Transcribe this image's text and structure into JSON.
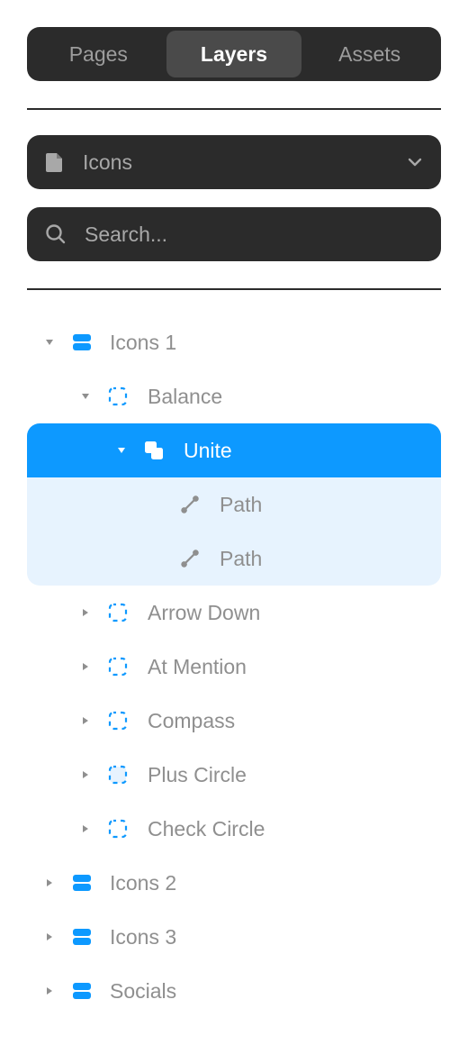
{
  "tabs": [
    {
      "label": "Pages",
      "active": false
    },
    {
      "label": "Layers",
      "active": true
    },
    {
      "label": "Assets",
      "active": false
    }
  ],
  "page_selector": {
    "icon": "page-icon",
    "label": "Icons",
    "chevron": "chevron-down-icon"
  },
  "search": {
    "icon": "search-icon",
    "placeholder": "Search...",
    "value": ""
  },
  "colors": {
    "accent": "#0d99ff",
    "selection_bg": "#e7f3fe",
    "panel_dark": "#2b2b2b"
  },
  "layers": {
    "icons1": {
      "label": "Icons 1",
      "icon": "section-icon",
      "expanded": true
    },
    "balance": {
      "label": "Balance",
      "icon": "frame-icon",
      "expanded": true
    },
    "unite": {
      "label": "Unite",
      "icon": "boolean-union-icon",
      "expanded": true,
      "selected": true
    },
    "path1": {
      "label": "Path",
      "icon": "path-icon"
    },
    "path2": {
      "label": "Path",
      "icon": "path-icon"
    },
    "arrow_down": {
      "label": "Arrow Down",
      "icon": "frame-icon",
      "expanded": false
    },
    "at_mention": {
      "label": "At Mention",
      "icon": "frame-icon",
      "expanded": false
    },
    "compass": {
      "label": "Compass",
      "icon": "frame-icon",
      "expanded": false
    },
    "plus_circle": {
      "label": "Plus Circle",
      "icon": "frame-icon",
      "expanded": false
    },
    "check_circle": {
      "label": "Check Circle",
      "icon": "frame-icon",
      "expanded": false
    },
    "icons2": {
      "label": "Icons 2",
      "icon": "section-icon",
      "expanded": false
    },
    "icons3": {
      "label": "Icons 3",
      "icon": "section-icon",
      "expanded": false
    },
    "socials": {
      "label": "Socials",
      "icon": "section-icon",
      "expanded": false
    }
  }
}
